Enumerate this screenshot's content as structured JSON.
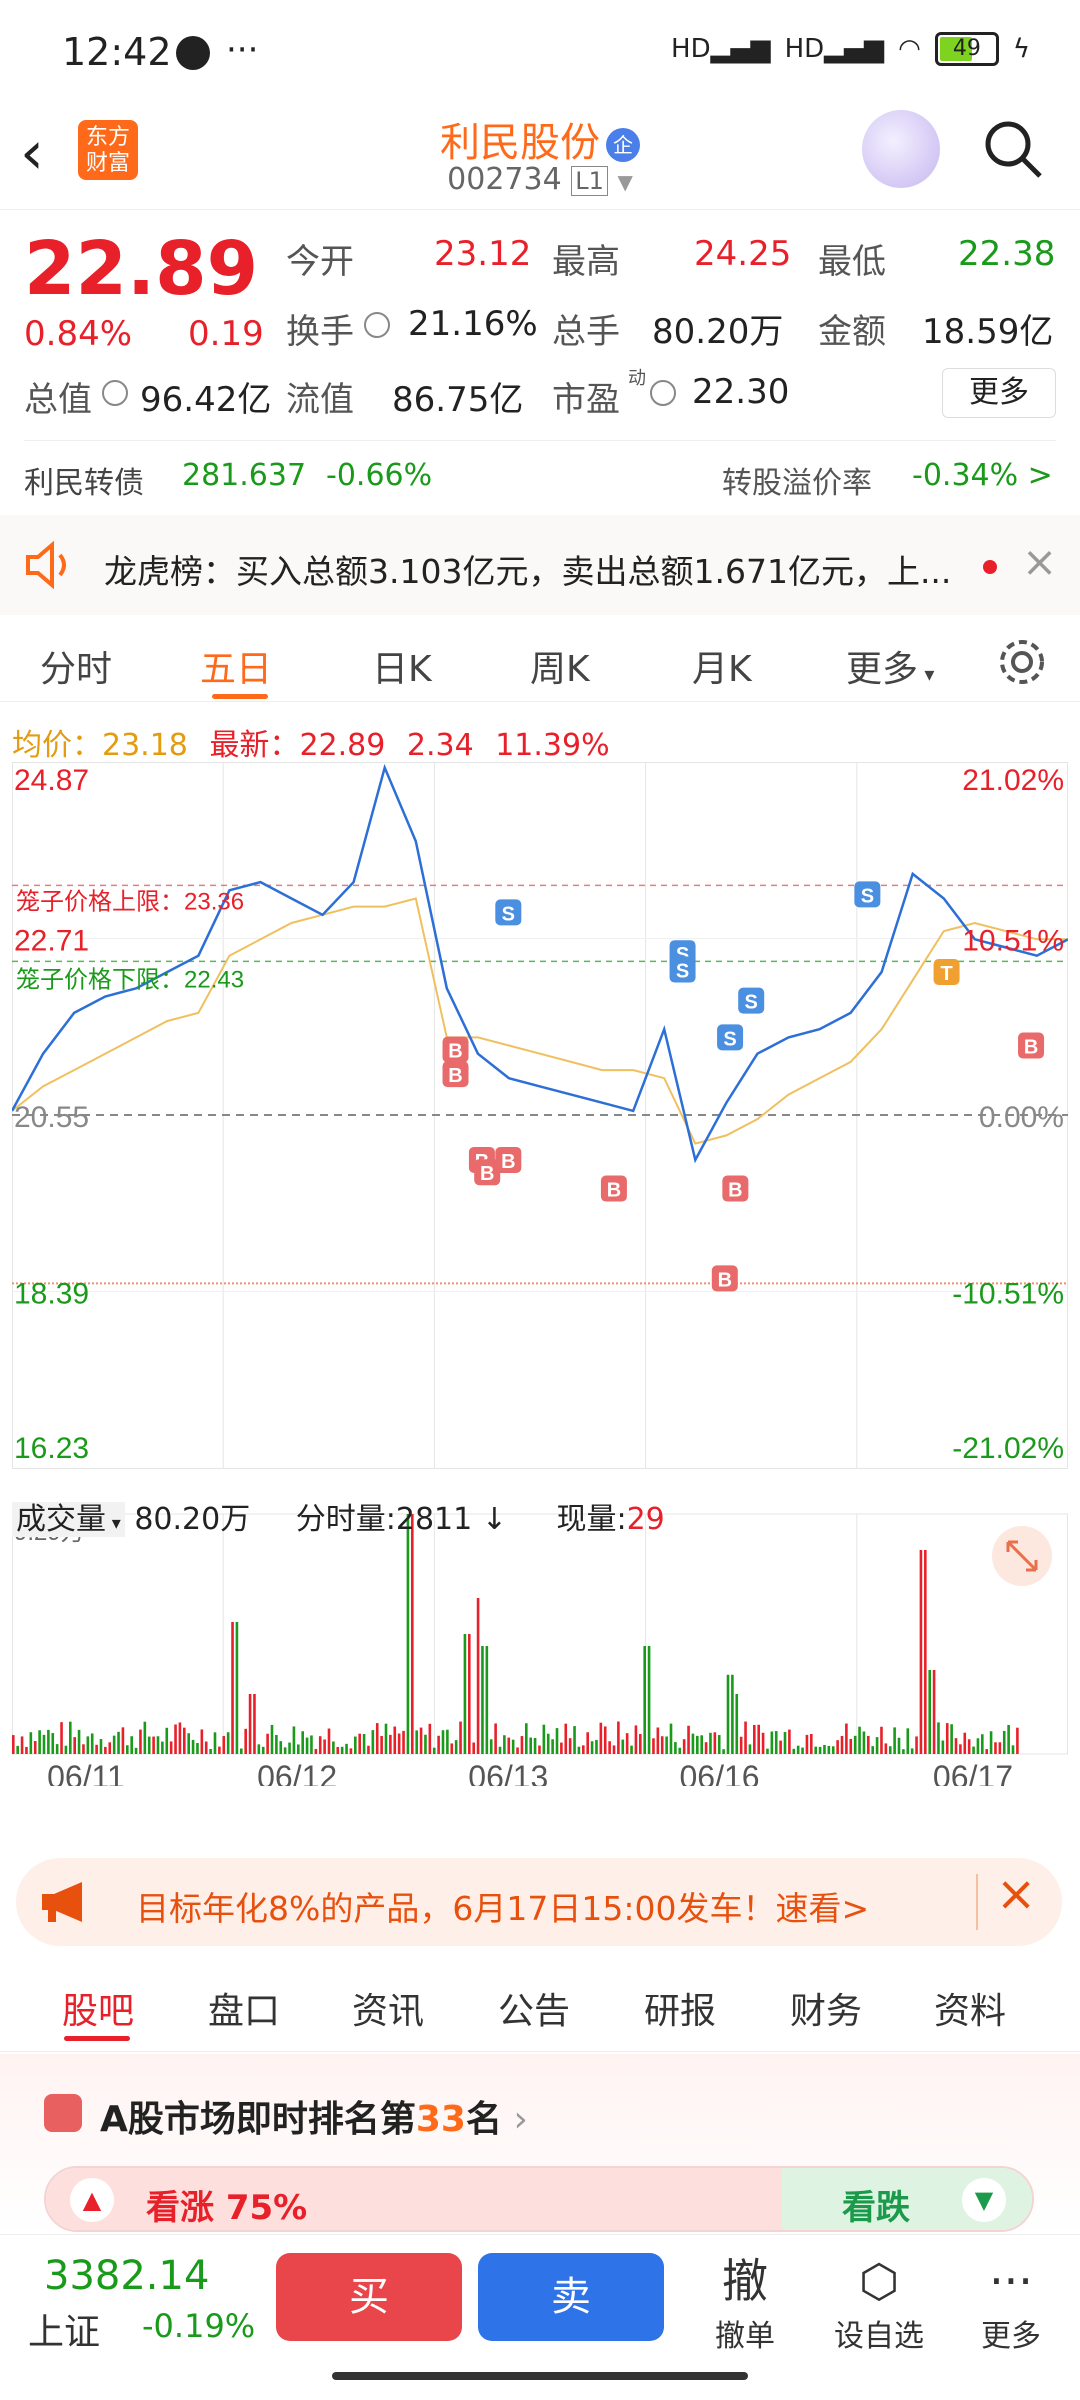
{
  "status": {
    "time": "12:42",
    "battery": "49"
  },
  "header": {
    "logo_text": "东方财富",
    "stock_name": "利民股份",
    "stock_code": "002734",
    "level_badge": "L1"
  },
  "quote": {
    "price": "22.89",
    "change_pct": "0.84%",
    "change_amt": "0.19",
    "open_label": "今开",
    "open": "23.12",
    "high_label": "最高",
    "high": "24.25",
    "low_label": "最低",
    "low": "22.38",
    "turnover_label": "换手",
    "turnover": "21.16%",
    "volume_label": "总手",
    "volume": "80.20万",
    "amount_label": "金额",
    "amount": "18.59亿",
    "mktcap_label": "总值",
    "mktcap": "96.42亿",
    "float_label": "流值",
    "float": "86.75亿",
    "pe_label": "市盈",
    "pe_sup": "动",
    "pe": "22.30",
    "more_label": "更多"
  },
  "bond": {
    "name": "利民转债",
    "price": "281.637",
    "chg": "-0.66%",
    "premium_label": "转股溢价率",
    "premium": "-0.34% >"
  },
  "notice": {
    "text": "龙虎榜：买入总额3.103亿元，卖出总额1.671亿元，上..."
  },
  "ktabs": [
    "分时",
    "五日",
    "日K",
    "周K",
    "月K",
    "更多"
  ],
  "summary": {
    "avg_label": "均价：",
    "avg": "23.18",
    "last_label": "最新：",
    "last": "22.89",
    "chg": "2.34",
    "chg_pct": "11.39%"
  },
  "chart_data": {
    "type": "line",
    "x_ticks": [
      "06/11",
      "06/12",
      "06/13",
      "06/16",
      "06/17"
    ],
    "y_left_ticks": [
      "24.87",
      "22.71",
      "20.55",
      "18.39",
      "16.23"
    ],
    "y_right_ticks": [
      "21.02%",
      "10.51%",
      "0.00%",
      "-10.51%",
      "-21.02%"
    ],
    "ylim": [
      16.23,
      24.87
    ],
    "prev_close": 20.55,
    "cage_upper_label": "笼子价格上限：23.36",
    "cage_upper": 23.36,
    "cage_lower_label": "笼子价格下限：22.43",
    "cage_lower": 22.43,
    "limit_down_line": 18.49,
    "series": [
      {
        "name": "均价",
        "color": "#f0c060",
        "values": [
          20.6,
          20.9,
          21.1,
          21.3,
          21.5,
          21.7,
          21.8,
          22.5,
          22.7,
          22.9,
          23.0,
          23.1,
          23.1,
          23.2,
          21.5,
          21.5,
          21.4,
          21.3,
          21.2,
          21.1,
          21.1,
          21.0,
          20.2,
          20.3,
          20.5,
          20.8,
          21.0,
          21.2,
          21.6,
          22.2,
          22.8,
          22.9,
          22.8,
          22.7,
          22.7
        ]
      },
      {
        "name": "价格",
        "color": "#2c6fd6",
        "values": [
          20.6,
          21.3,
          21.8,
          22.0,
          22.1,
          22.3,
          22.5,
          23.3,
          23.4,
          23.2,
          23.0,
          23.4,
          24.8,
          23.9,
          22.1,
          21.3,
          21.0,
          20.9,
          20.8,
          20.7,
          20.6,
          21.6,
          20.0,
          20.7,
          21.3,
          21.5,
          21.6,
          21.8,
          22.3,
          23.5,
          23.2,
          22.7,
          22.6,
          22.5,
          22.7
        ]
      }
    ],
    "volume": {
      "label": "成交量",
      "total": "80.20万",
      "max_label": "9.29万",
      "tick_label": "分时量:",
      "tick_value": "2811",
      "now_label": "现量:",
      "now_value": "29"
    },
    "markers": [
      {
        "t": "S",
        "x": 0.47,
        "y": 23.03
      },
      {
        "t": "S",
        "x": 0.635,
        "y": 22.53
      },
      {
        "t": "S",
        "x": 0.635,
        "y": 22.33
      },
      {
        "t": "S",
        "x": 0.7,
        "y": 21.95
      },
      {
        "t": "S",
        "x": 0.68,
        "y": 21.5
      },
      {
        "t": "S",
        "x": 0.81,
        "y": 23.25
      },
      {
        "t": "B",
        "x": 0.42,
        "y": 21.35
      },
      {
        "t": "B",
        "x": 0.42,
        "y": 21.05
      },
      {
        "t": "B",
        "x": 0.445,
        "y": 20.0
      },
      {
        "t": "B",
        "x": 0.47,
        "y": 20.0
      },
      {
        "t": "B",
        "x": 0.45,
        "y": 19.85
      },
      {
        "t": "B",
        "x": 0.57,
        "y": 19.65
      },
      {
        "t": "B",
        "x": 0.685,
        "y": 19.65
      },
      {
        "t": "B",
        "x": 0.675,
        "y": 18.55
      },
      {
        "t": "B",
        "x": 0.965,
        "y": 21.4
      },
      {
        "t": "T",
        "x": 0.885,
        "y": 22.3
      }
    ]
  },
  "promo": {
    "text": "目标年化8%的产品，6月17日15:00发车！速看>"
  },
  "ftabs": [
    "股吧",
    "盘口",
    "资讯",
    "公告",
    "研报",
    "财务",
    "资料"
  ],
  "rank": {
    "prefix": "A股市场即时排名第",
    "num": "33",
    "suffix": "名",
    "up_label": "看涨 75%",
    "down_label": "看跌"
  },
  "bottom": {
    "index_value": "3382.14",
    "index_name": "上证",
    "index_chg": "-0.19%",
    "buy": "买",
    "sell": "卖",
    "cancel_icon": "撤",
    "cancel": "撤单",
    "watch": "设自选",
    "more": "更多"
  }
}
